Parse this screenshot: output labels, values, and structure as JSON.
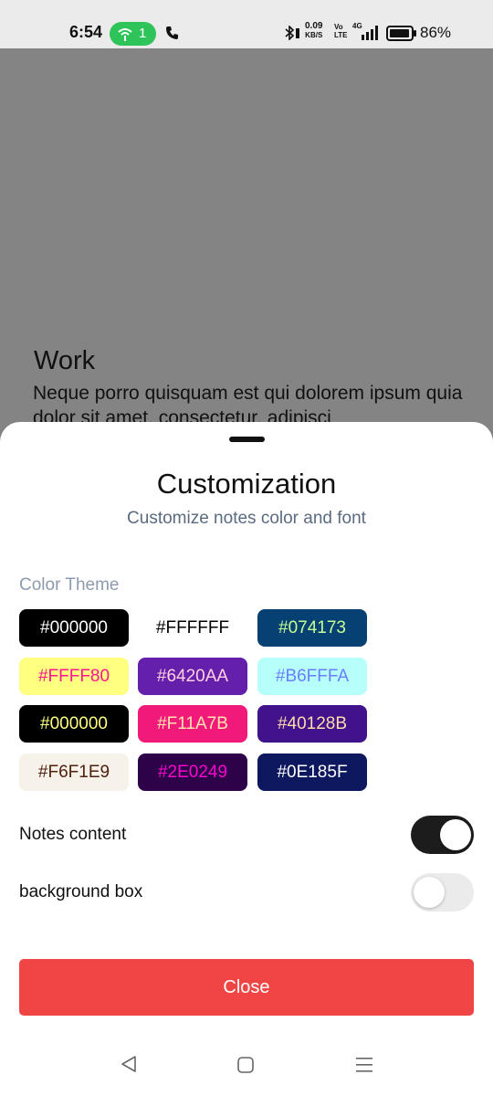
{
  "status_bar": {
    "time": "6:54",
    "hotspot_count": "1",
    "net_speed": "0.09",
    "net_speed_unit": "KB/S",
    "volte_top": "Vo",
    "volte_bottom": "LTE",
    "network_type": "4G",
    "battery": "86%",
    "icons": [
      "hotspot-icon",
      "call-icon",
      "bluetooth-icon",
      "signal-icon",
      "battery-icon"
    ]
  },
  "background_note": {
    "title": "Work",
    "body": "Neque porro quisquam est qui dolorem ipsum quia dolor sit amet, consectetur, adipisci"
  },
  "sheet": {
    "title": "Customization",
    "subtitle": "Customize notes color and font",
    "color_theme_label": "Color Theme",
    "swatches": [
      {
        "label": "#000000",
        "bg": "#000000",
        "text": "#FFFFFF"
      },
      {
        "label": "#FFFFFF",
        "bg": "#FFFFFF",
        "text": "#000000"
      },
      {
        "label": "#074173",
        "bg": "#074173",
        "text": "#C5FF95"
      },
      {
        "label": "#FFFF80",
        "bg": "#FFFF80",
        "text": "#FF1493"
      },
      {
        "label": "#6420AA",
        "bg": "#6420AA",
        "text": "#FFD1E3"
      },
      {
        "label": "#B6FFFA",
        "bg": "#B6FFFA",
        "text": "#687EFF"
      },
      {
        "label": "#000000",
        "bg": "#000000",
        "text": "#FFFF80"
      },
      {
        "label": "#F11A7B",
        "bg": "#F11A7B",
        "text": "#FFE5AD"
      },
      {
        "label": "#40128B",
        "bg": "#40128B",
        "text": "#FFDBAA"
      },
      {
        "label": "#F6F1E9",
        "bg": "#F6F1E9",
        "text": "#4F200D"
      },
      {
        "label": "#2E0249",
        "bg": "#2E0249",
        "text": "#F806CC"
      },
      {
        "label": "#0E185F",
        "bg": "#0E185F",
        "text": "#FFFFFF"
      }
    ],
    "settings": [
      {
        "label": "Notes content",
        "enabled": true
      },
      {
        "label": "background box",
        "enabled": false
      }
    ],
    "close_label": "Close"
  },
  "nav_bar": {
    "icons": [
      "back-icon",
      "home-icon",
      "menu-icon"
    ]
  }
}
